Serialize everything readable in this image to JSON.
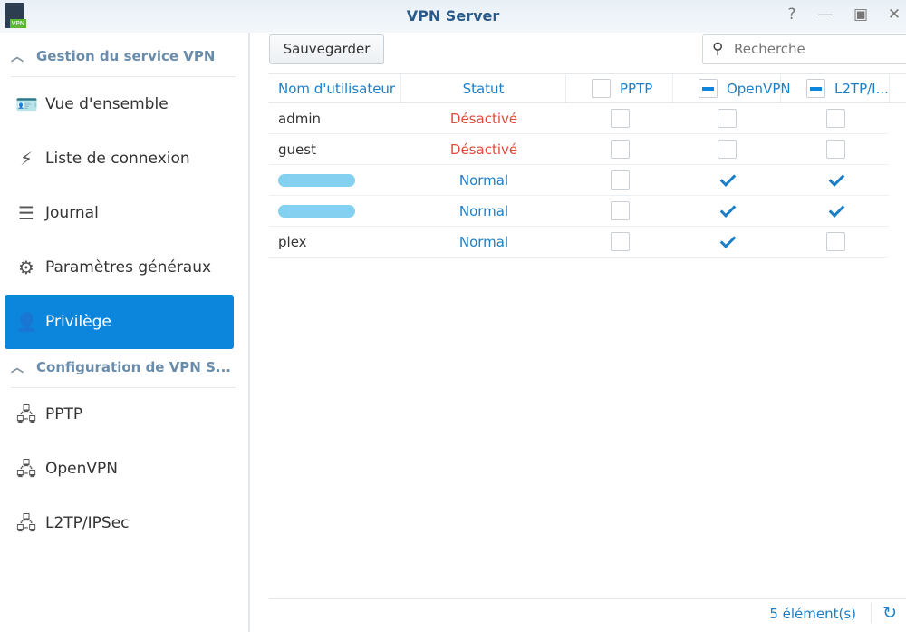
{
  "window": {
    "title": "VPN Server",
    "app_icon_label": "VPN"
  },
  "sidebar": {
    "sections": [
      {
        "label": "Gestion du service VPN",
        "items": [
          {
            "label": "Vue d'ensemble",
            "icon": "overview-icon"
          },
          {
            "label": "Liste de connexion",
            "icon": "plug-icon"
          },
          {
            "label": "Journal",
            "icon": "log-icon"
          },
          {
            "label": "Paramètres généraux",
            "icon": "gear-icon"
          },
          {
            "label": "Privilège",
            "icon": "user-lock-icon",
            "selected": true
          }
        ]
      },
      {
        "label": "Configuration de VPN S...",
        "items": [
          {
            "label": "PPTP",
            "icon": "network-icon"
          },
          {
            "label": "OpenVPN",
            "icon": "network-icon"
          },
          {
            "label": "L2TP/IPSec",
            "icon": "network-icon"
          }
        ]
      }
    ]
  },
  "toolbar": {
    "save_label": "Sauvegarder",
    "search_placeholder": "Recherche"
  },
  "table": {
    "headers": {
      "user": "Nom d'utilisateur",
      "status": "Statut",
      "pptp": "PPTP",
      "openvpn": "OpenVPN",
      "l2tp": "L2TP/I..."
    },
    "rows": [
      {
        "user": "admin",
        "status": "Désactivé",
        "pptp": false,
        "openvpn": false,
        "l2tp": false
      },
      {
        "user": "guest",
        "status": "Désactivé",
        "pptp": false,
        "openvpn": false,
        "l2tp": false
      },
      {
        "user": "",
        "redacted": true,
        "status": "Normal",
        "pptp": false,
        "openvpn": true,
        "l2tp": true
      },
      {
        "user": "",
        "redacted": true,
        "status": "Normal",
        "pptp": false,
        "openvpn": true,
        "l2tp": true
      },
      {
        "user": "plex",
        "status": "Normal",
        "pptp": false,
        "openvpn": true,
        "l2tp": false
      }
    ]
  },
  "footer": {
    "count": "5 élément(s)"
  },
  "colors": {
    "accent": "#0b86dc",
    "disabled": "#e04a3a",
    "normal": "#1b7fc8"
  }
}
